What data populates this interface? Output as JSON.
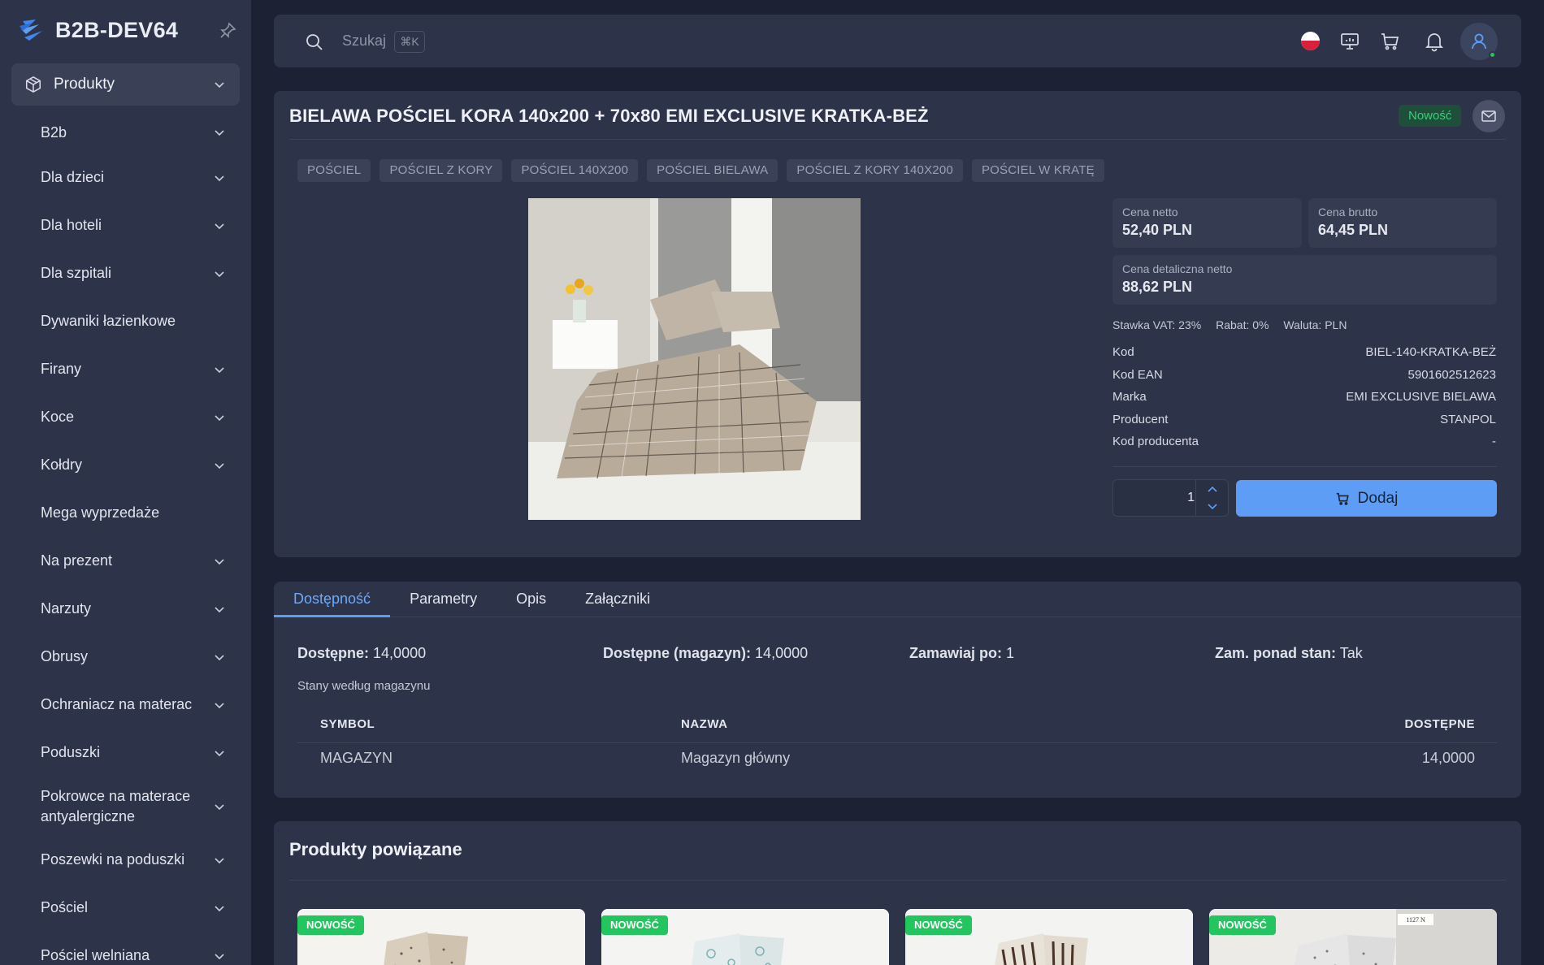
{
  "sidebar": {
    "brand": "B2B-DEV64",
    "main_item": "Produkty",
    "items": [
      {
        "label": "B2b"
      },
      {
        "label": "Dla dzieci"
      },
      {
        "label": "Dla hoteli"
      },
      {
        "label": "Dla szpitali"
      },
      {
        "label": "Dywaniki łazienkowe"
      },
      {
        "label": "Firany"
      },
      {
        "label": "Koce"
      },
      {
        "label": "Kołdry"
      },
      {
        "label": "Mega wyprzedaże"
      },
      {
        "label": "Na prezent"
      },
      {
        "label": "Narzuty"
      },
      {
        "label": "Obrusy"
      },
      {
        "label": "Ochraniacz na materac"
      },
      {
        "label": "Poduszki"
      },
      {
        "label": "Pokrowce na materace antyalergiczne"
      },
      {
        "label": "Poszewki na poduszki"
      },
      {
        "label": "Pościel"
      },
      {
        "label": "Pościel welniana"
      }
    ]
  },
  "topbar": {
    "search_placeholder": "Szukaj",
    "shortcut": "⌘K"
  },
  "product": {
    "title": "BIELAWA POŚCIEL KORA 140x200 + 70x80 EMI EXCLUSIVE KRATKA-BEŻ",
    "badge": "Nowość",
    "tags": [
      "POŚCIEL",
      "POŚCIEL Z KORY",
      "POŚCIEL 140X200",
      "POŚCIEL BIELAWA",
      "POŚCIEL Z KORY 140X200",
      "POŚCIEL W KRATĘ"
    ],
    "prices": {
      "netto_label": "Cena netto",
      "netto": "52,40 PLN",
      "brutto_label": "Cena brutto",
      "brutto": "64,45 PLN",
      "retail_label": "Cena detaliczna netto",
      "retail": "88,62 PLN"
    },
    "vat": "Stawka VAT: 23%",
    "discount": "Rabat: 0%",
    "currency": "Waluta: PLN",
    "attributes": [
      {
        "label": "Kod",
        "value": "BIEL-140-KRATKA-BEŻ"
      },
      {
        "label": "Kod EAN",
        "value": "5901602512623"
      },
      {
        "label": "Marka",
        "value": "EMI EXCLUSIVE BIELAWA"
      },
      {
        "label": "Producent",
        "value": "STANPOL"
      },
      {
        "label": "Kod producenta",
        "value": "-"
      }
    ],
    "quantity": "1",
    "add_label": "Dodaj"
  },
  "tabs": [
    "Dostępność",
    "Parametry",
    "Opis",
    "Załączniki"
  ],
  "availability": {
    "available_label": "Dostępne:",
    "available": "14,0000",
    "warehouse_label": "Dostępne (magazyn):",
    "warehouse": "14,0000",
    "order_after_label": "Zamawiaj po:",
    "order_after": "1",
    "over_stock_label": "Zam. ponad stan:",
    "over_stock": "Tak",
    "subtitle": "Stany według magazynu",
    "columns": [
      "SYMBOL",
      "NAZWA",
      "DOSTĘPNE"
    ],
    "rows": [
      {
        "symbol": "MAGAZYN",
        "name": "Magazyn główny",
        "available": "14,0000"
      }
    ]
  },
  "related": {
    "title": "Produkty powiązane",
    "badge": "NOWOŚĆ",
    "label_1127": "1127 N"
  },
  "colors": {
    "accent": "#5d9df6",
    "success": "#22c55e",
    "panel": "#2d3348",
    "background": "#1c2234"
  }
}
